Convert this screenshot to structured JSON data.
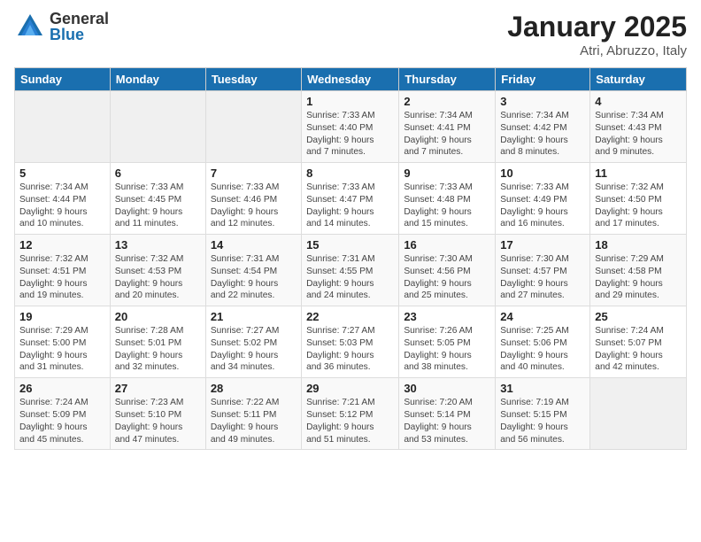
{
  "logo": {
    "general": "General",
    "blue": "Blue"
  },
  "title": "January 2025",
  "location": "Atri, Abruzzo, Italy",
  "days_of_week": [
    "Sunday",
    "Monday",
    "Tuesday",
    "Wednesday",
    "Thursday",
    "Friday",
    "Saturday"
  ],
  "weeks": [
    [
      {
        "day": "",
        "info": ""
      },
      {
        "day": "",
        "info": ""
      },
      {
        "day": "",
        "info": ""
      },
      {
        "day": "1",
        "info": "Sunrise: 7:33 AM\nSunset: 4:40 PM\nDaylight: 9 hours\nand 7 minutes."
      },
      {
        "day": "2",
        "info": "Sunrise: 7:34 AM\nSunset: 4:41 PM\nDaylight: 9 hours\nand 7 minutes."
      },
      {
        "day": "3",
        "info": "Sunrise: 7:34 AM\nSunset: 4:42 PM\nDaylight: 9 hours\nand 8 minutes."
      },
      {
        "day": "4",
        "info": "Sunrise: 7:34 AM\nSunset: 4:43 PM\nDaylight: 9 hours\nand 9 minutes."
      }
    ],
    [
      {
        "day": "5",
        "info": "Sunrise: 7:34 AM\nSunset: 4:44 PM\nDaylight: 9 hours\nand 10 minutes."
      },
      {
        "day": "6",
        "info": "Sunrise: 7:33 AM\nSunset: 4:45 PM\nDaylight: 9 hours\nand 11 minutes."
      },
      {
        "day": "7",
        "info": "Sunrise: 7:33 AM\nSunset: 4:46 PM\nDaylight: 9 hours\nand 12 minutes."
      },
      {
        "day": "8",
        "info": "Sunrise: 7:33 AM\nSunset: 4:47 PM\nDaylight: 9 hours\nand 14 minutes."
      },
      {
        "day": "9",
        "info": "Sunrise: 7:33 AM\nSunset: 4:48 PM\nDaylight: 9 hours\nand 15 minutes."
      },
      {
        "day": "10",
        "info": "Sunrise: 7:33 AM\nSunset: 4:49 PM\nDaylight: 9 hours\nand 16 minutes."
      },
      {
        "day": "11",
        "info": "Sunrise: 7:32 AM\nSunset: 4:50 PM\nDaylight: 9 hours\nand 17 minutes."
      }
    ],
    [
      {
        "day": "12",
        "info": "Sunrise: 7:32 AM\nSunset: 4:51 PM\nDaylight: 9 hours\nand 19 minutes."
      },
      {
        "day": "13",
        "info": "Sunrise: 7:32 AM\nSunset: 4:53 PM\nDaylight: 9 hours\nand 20 minutes."
      },
      {
        "day": "14",
        "info": "Sunrise: 7:31 AM\nSunset: 4:54 PM\nDaylight: 9 hours\nand 22 minutes."
      },
      {
        "day": "15",
        "info": "Sunrise: 7:31 AM\nSunset: 4:55 PM\nDaylight: 9 hours\nand 24 minutes."
      },
      {
        "day": "16",
        "info": "Sunrise: 7:30 AM\nSunset: 4:56 PM\nDaylight: 9 hours\nand 25 minutes."
      },
      {
        "day": "17",
        "info": "Sunrise: 7:30 AM\nSunset: 4:57 PM\nDaylight: 9 hours\nand 27 minutes."
      },
      {
        "day": "18",
        "info": "Sunrise: 7:29 AM\nSunset: 4:58 PM\nDaylight: 9 hours\nand 29 minutes."
      }
    ],
    [
      {
        "day": "19",
        "info": "Sunrise: 7:29 AM\nSunset: 5:00 PM\nDaylight: 9 hours\nand 31 minutes."
      },
      {
        "day": "20",
        "info": "Sunrise: 7:28 AM\nSunset: 5:01 PM\nDaylight: 9 hours\nand 32 minutes."
      },
      {
        "day": "21",
        "info": "Sunrise: 7:27 AM\nSunset: 5:02 PM\nDaylight: 9 hours\nand 34 minutes."
      },
      {
        "day": "22",
        "info": "Sunrise: 7:27 AM\nSunset: 5:03 PM\nDaylight: 9 hours\nand 36 minutes."
      },
      {
        "day": "23",
        "info": "Sunrise: 7:26 AM\nSunset: 5:05 PM\nDaylight: 9 hours\nand 38 minutes."
      },
      {
        "day": "24",
        "info": "Sunrise: 7:25 AM\nSunset: 5:06 PM\nDaylight: 9 hours\nand 40 minutes."
      },
      {
        "day": "25",
        "info": "Sunrise: 7:24 AM\nSunset: 5:07 PM\nDaylight: 9 hours\nand 42 minutes."
      }
    ],
    [
      {
        "day": "26",
        "info": "Sunrise: 7:24 AM\nSunset: 5:09 PM\nDaylight: 9 hours\nand 45 minutes."
      },
      {
        "day": "27",
        "info": "Sunrise: 7:23 AM\nSunset: 5:10 PM\nDaylight: 9 hours\nand 47 minutes."
      },
      {
        "day": "28",
        "info": "Sunrise: 7:22 AM\nSunset: 5:11 PM\nDaylight: 9 hours\nand 49 minutes."
      },
      {
        "day": "29",
        "info": "Sunrise: 7:21 AM\nSunset: 5:12 PM\nDaylight: 9 hours\nand 51 minutes."
      },
      {
        "day": "30",
        "info": "Sunrise: 7:20 AM\nSunset: 5:14 PM\nDaylight: 9 hours\nand 53 minutes."
      },
      {
        "day": "31",
        "info": "Sunrise: 7:19 AM\nSunset: 5:15 PM\nDaylight: 9 hours\nand 56 minutes."
      },
      {
        "day": "",
        "info": ""
      }
    ]
  ]
}
